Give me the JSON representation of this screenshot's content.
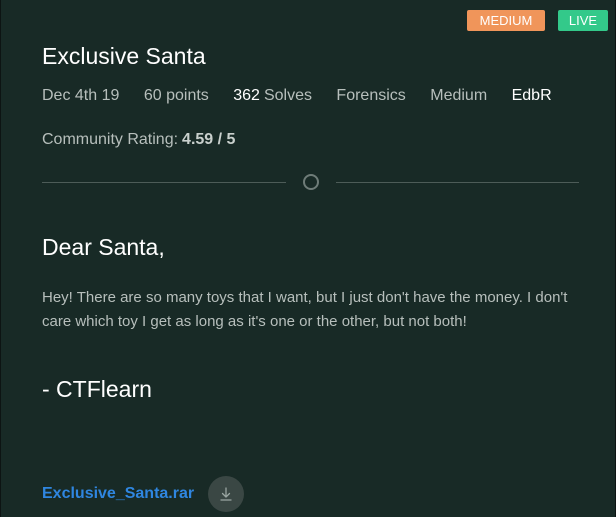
{
  "badges": {
    "difficulty": "MEDIUM",
    "status": "LIVE"
  },
  "challenge": {
    "title": "Exclusive Santa",
    "date": "Dec 4th 19",
    "points": "60 points",
    "solves_count": "362",
    "solves_label": "Solves",
    "category": "Forensics",
    "difficulty": "Medium",
    "author": "EdbR"
  },
  "rating": {
    "label": "Community Rating:",
    "value": "4.59 / 5"
  },
  "description": {
    "greeting": "Dear Santa,",
    "body": "Hey! There are so many toys that I want, but I just don't have the money. I don't care which toy I get as long as it's one or the other, but not both!",
    "signature": "- CTFlearn"
  },
  "attachment": {
    "file_name": "Exclusive_Santa.rar",
    "download_icon": "download-icon"
  },
  "colors": {
    "background": "#182a26",
    "badge_medium": "#f0955a",
    "badge_live": "#33c98a",
    "link": "#2f86e0"
  }
}
